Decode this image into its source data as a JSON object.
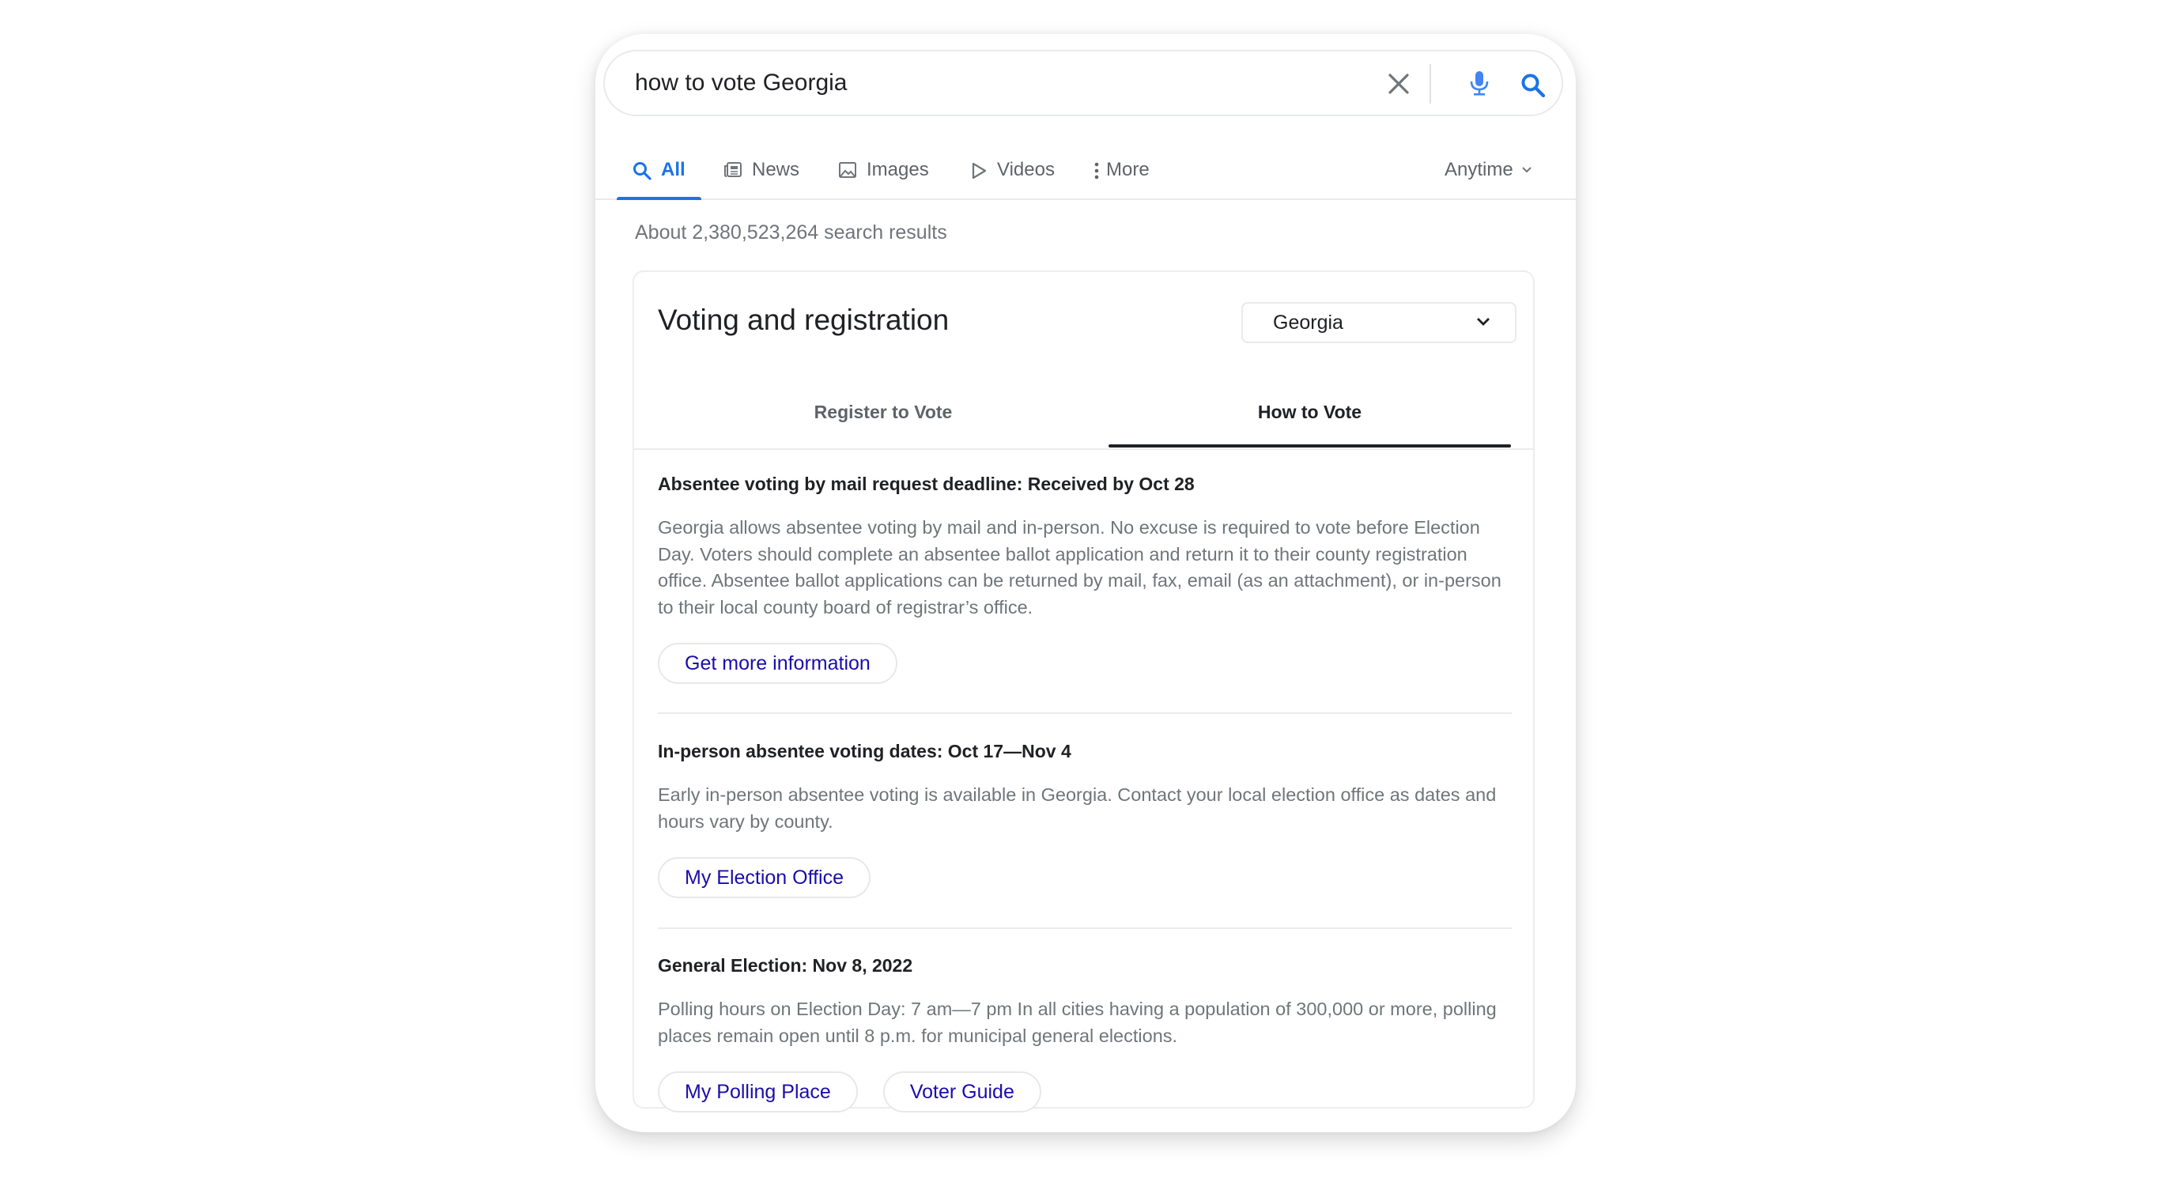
{
  "search": {
    "query": "how to vote Georgia",
    "clear_icon": "close-icon",
    "mic_icon": "microphone-icon",
    "search_icon": "search-icon"
  },
  "nav": {
    "tabs": [
      {
        "label": "All",
        "icon": "search-icon",
        "active": true
      },
      {
        "label": "News",
        "icon": "newspaper-icon",
        "active": false
      },
      {
        "label": "Images",
        "icon": "image-icon",
        "active": false
      },
      {
        "label": "Videos",
        "icon": "play-icon",
        "active": false
      },
      {
        "label": "More",
        "icon": "kebab-icon",
        "active": false
      }
    ],
    "time_filter": "Anytime"
  },
  "results": {
    "count_text": "About 2,380,523,264 search results"
  },
  "voting_card": {
    "title": "Voting and registration",
    "state_select": {
      "value": "Georgia"
    },
    "tabs": [
      {
        "label": "Register to Vote",
        "active": false
      },
      {
        "label": "How to Vote",
        "active": true
      }
    ],
    "sections": [
      {
        "heading": "Absentee voting by mail request deadline: Received by Oct 28",
        "body": "Georgia allows absentee voting by mail and in-person. No excuse is required to vote before Election Day. Voters should complete an absentee ballot application and return it to their county registration office. Absentee ballot applications can be returned by mail, fax, email (as an attachment), or in-person to their local county board of registrar’s office.",
        "buttons": [
          "Get more information"
        ]
      },
      {
        "heading": "In-person absentee voting dates: Oct 17—Nov 4",
        "body": "Early in-person absentee voting is available in Georgia. Contact your local election office as dates and hours vary by county.",
        "buttons": [
          "My Election Office"
        ]
      },
      {
        "heading": "General Election: Nov 8, 2022",
        "body": "Polling hours on Election Day: 7 am—7 pm In all cities having a population of 300,000 or more, polling places remain open until 8 p.m. for municipal general elections.",
        "buttons": [
          "My Polling Place",
          "Voter Guide"
        ]
      }
    ]
  },
  "colors": {
    "accent_blue": "#1a73e8",
    "link_blue": "#1a0dab",
    "text_primary": "#202124",
    "text_secondary": "#70757a",
    "icon_gray": "#5f6368"
  }
}
